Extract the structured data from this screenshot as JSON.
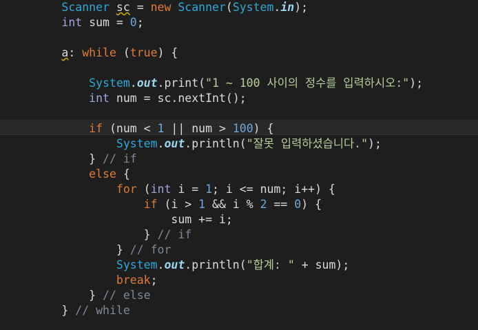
{
  "editor": {
    "lines": [
      "Scanner sc = new Scanner(System.in);",
      "int sum = 0;",
      "",
      "a: while (true) {",
      "",
      "    System.out.print(\"1 ~ 100 사이의 정수를 입력하시오:\");",
      "    int num = sc.nextInt();",
      "",
      "    if (num < 1 || num > 100) {",
      "        System.out.println(\"잘못 입력하셨습니다.\");",
      "    } // if",
      "    else {",
      "        for (int i = 1; i <= num; i++) {",
      "            if (i > 1 && i % 2 == 0) {",
      "                sum += i;",
      "            } // if",
      "        } // for",
      "        System.out.println(\"합계: \" + sum);",
      "        break;",
      "    } // else",
      "} // while"
    ],
    "highlighted_line_index": 8,
    "colors": {
      "background": "#1e1e1e",
      "keyword": "#e07b39",
      "type": "#9ca9e0",
      "class": "#2ea8d8",
      "string": "#b5ce9a",
      "number": "#6fa8dc",
      "comment": "#7c8a99"
    }
  }
}
